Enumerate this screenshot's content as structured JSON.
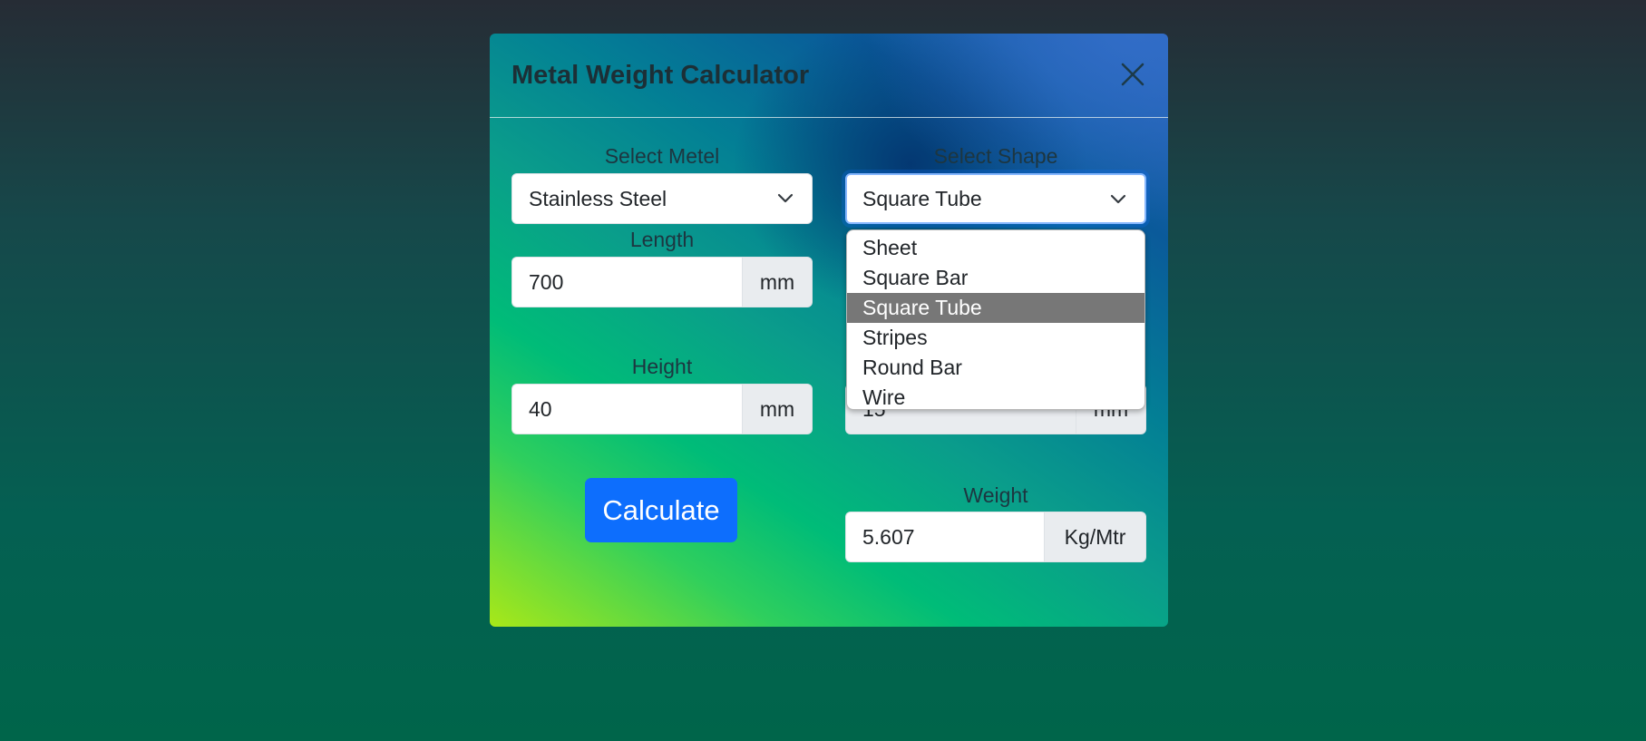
{
  "modal": {
    "title": "Metal Weight Calculator",
    "close_icon": "close-icon"
  },
  "metal": {
    "label": "Select Metel",
    "value": "Stainless Steel"
  },
  "shape": {
    "label": "Select Shape",
    "value": "Square Tube",
    "options": [
      "Sheet",
      "Square Bar",
      "Square Tube",
      "Stripes",
      "Round Bar",
      "Wire"
    ],
    "highlighted": "Square Tube"
  },
  "length": {
    "label": "Length",
    "value": "700",
    "unit": "mm"
  },
  "height": {
    "label": "Height",
    "value": "40",
    "unit": "mm"
  },
  "hidden_field": {
    "value": "15",
    "unit": "mm"
  },
  "calculate": {
    "label": "Calculate"
  },
  "weight": {
    "label": "Weight",
    "value": "5.607",
    "unit": "Kg/Mtr"
  },
  "colors": {
    "primary_button": "#0d6efd",
    "option_highlight": "#777777"
  }
}
